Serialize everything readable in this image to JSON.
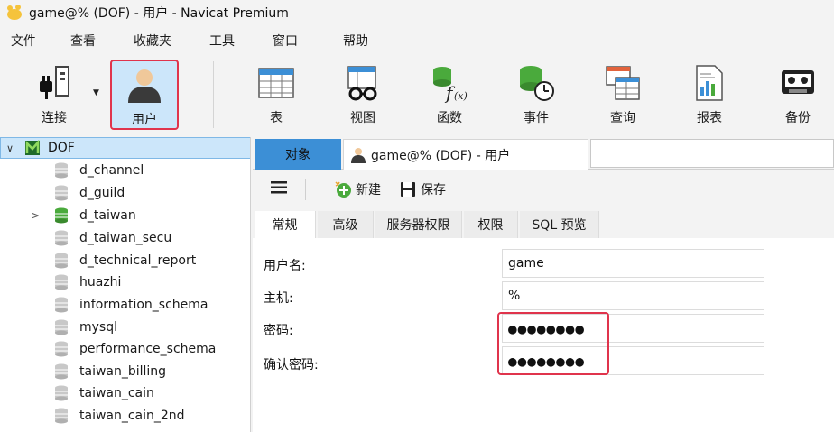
{
  "window": {
    "title": "game@% (DOF) - 用户 - Navicat Premium"
  },
  "menu": [
    "文件",
    "查看",
    "收藏夹",
    "工具",
    "窗口",
    "帮助"
  ],
  "toolbar": {
    "connect": "连接",
    "user": "用户",
    "table": "表",
    "view": "视图",
    "function": "函数",
    "event": "事件",
    "query": "查询",
    "report": "报表",
    "backup": "备份"
  },
  "tree": {
    "root": "DOF",
    "items": [
      "d_channel",
      "d_guild",
      "d_taiwan",
      "d_taiwan_secu",
      "d_technical_report",
      "huazhi",
      "information_schema",
      "mysql",
      "performance_schema",
      "taiwan_billing",
      "taiwan_cain",
      "taiwan_cain_2nd"
    ]
  },
  "tabs": {
    "objects": "对象",
    "user_tab": "game@% (DOF) - 用户"
  },
  "subtoolbar": {
    "new": "新建",
    "save": "保存"
  },
  "property_tabs": [
    "常规",
    "高级",
    "服务器权限",
    "权限",
    "SQL 预览"
  ],
  "form": {
    "username_label": "用户名:",
    "username_value": "game",
    "host_label": "主机:",
    "host_value": "%",
    "password_label": "密码:",
    "password_value": "●●●●●●●●",
    "confirm_label": "确认密码:",
    "confirm_value": "●●●●●●●●"
  },
  "colors": {
    "accent_selected": "#cce6fa",
    "highlight_red": "#e0344c",
    "objects_tab": "#3c8fd6",
    "db_green": "#3aa845"
  }
}
